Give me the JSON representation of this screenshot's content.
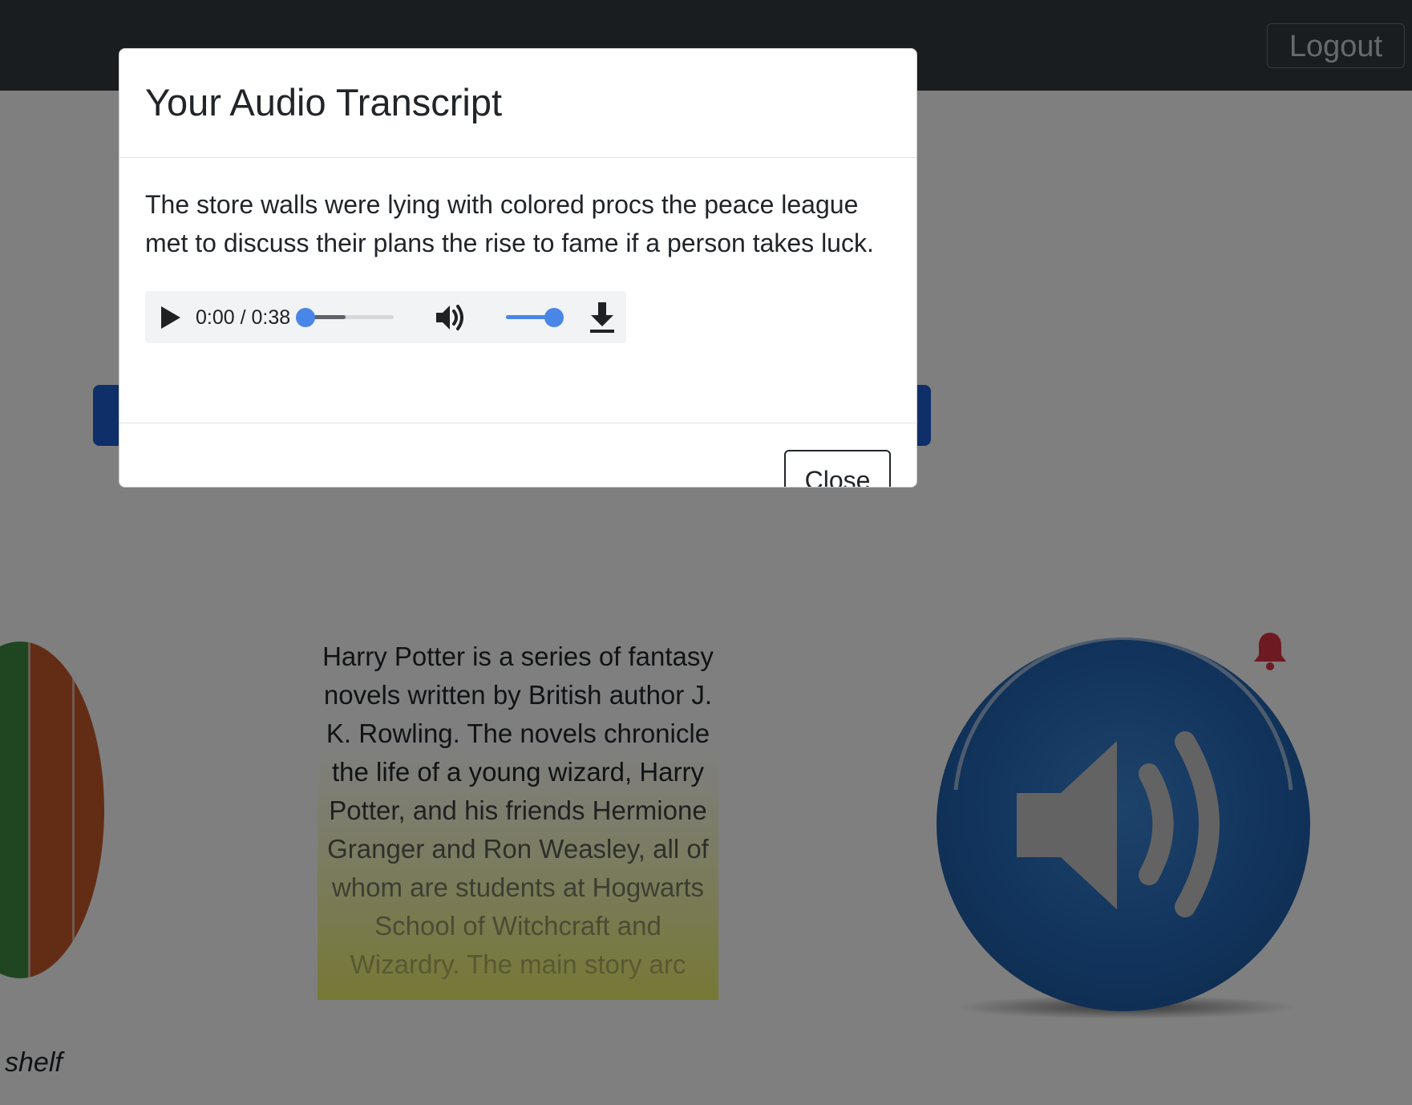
{
  "navbar": {
    "logout_label": "Logout"
  },
  "book": {
    "shelf_caption": "shelf",
    "description": "Harry Potter is a series of fantasy novels written by British author J. K. Rowling. The novels chronicle the life of a young wizard, Harry Potter, and his friends Hermione Granger and Ron Weasley, all of whom are students at Hogwarts School of Witchcraft and Wizardry. The main story arc"
  },
  "modal": {
    "title": "Your Audio Transcript",
    "transcript": "The store walls were lying with colored procs the peace league met to discuss their plans the rise to fame if a person takes luck.",
    "audio": {
      "time_display": "0:00 / 0:38",
      "progress_fraction": 0.0,
      "volume_fraction": 1.0
    },
    "close_label": "Close"
  },
  "icons": {
    "play": "play-icon",
    "mute": "volume-icon",
    "download": "download-icon",
    "speaker": "speaker-icon",
    "bell": "bell-icon"
  },
  "colors": {
    "navbar": "#343a40",
    "primary": "#1e5fd0",
    "player_accent": "#4a86e8",
    "speaker_blue": "#2468b8",
    "bell": "#dc3545"
  }
}
